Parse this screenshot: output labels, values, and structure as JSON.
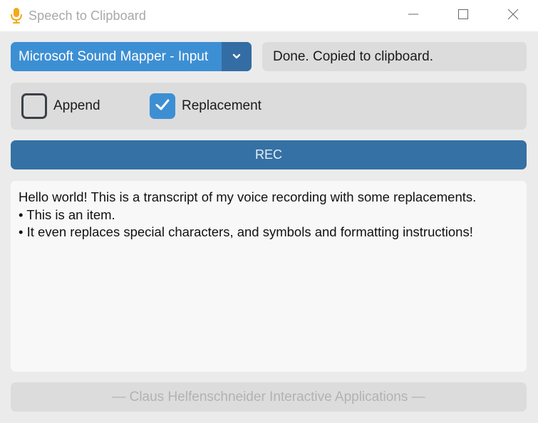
{
  "window": {
    "title": "Speech to Clipboard",
    "icons": {
      "app": "microphone-icon",
      "minimize": "minimize-icon",
      "maximize": "maximize-icon",
      "close": "close-icon"
    }
  },
  "device": {
    "selected": "Microsoft Sound Mapper - Input",
    "arrow_icon": "chevron-down-icon"
  },
  "status": {
    "text": "Done. Copied to clipboard."
  },
  "options": {
    "append": {
      "label": "Append",
      "checked": false
    },
    "replacement": {
      "label": "Replacement",
      "checked": true
    }
  },
  "rec": {
    "label": "REC"
  },
  "transcript": {
    "lines": [
      "Hello world! This is a transcript of my voice recording with some replacements.",
      "• This is an item.",
      "• It even replaces special characters, and symbols and formatting instructions!"
    ]
  },
  "footer": {
    "text": "— Claus Helfenschneider Interactive Applications —"
  },
  "colors": {
    "accent": "#3d8fd3",
    "accent_dark": "#346da3",
    "rec": "#3571a5",
    "mic": "#f2a91c"
  }
}
